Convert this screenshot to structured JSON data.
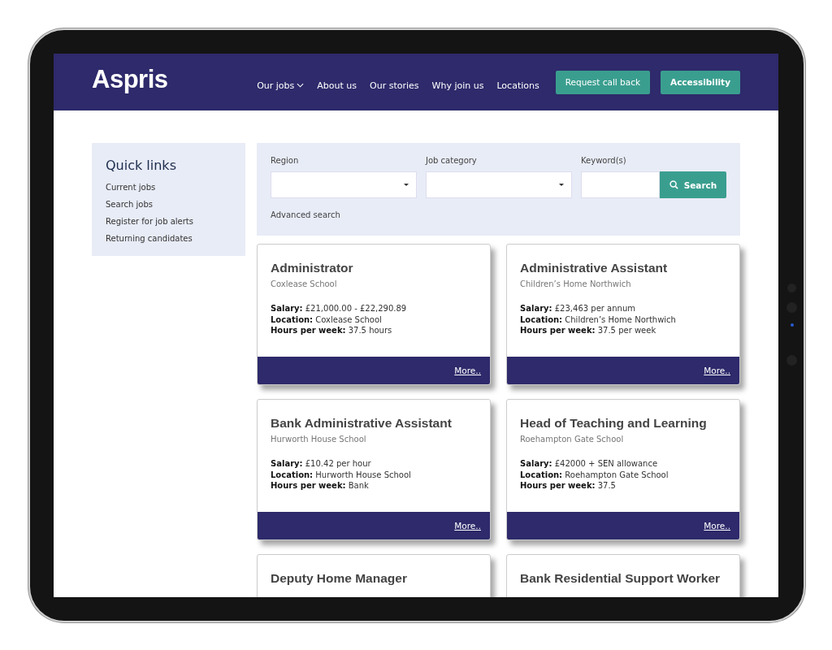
{
  "header": {
    "logo": "Aspris",
    "nav": [
      {
        "label": "Our jobs",
        "dropdown": true
      },
      {
        "label": "About us",
        "dropdown": false
      },
      {
        "label": "Our stories",
        "dropdown": false
      },
      {
        "label": "Why join us",
        "dropdown": false
      },
      {
        "label": "Locations",
        "dropdown": false
      }
    ],
    "buttons": [
      {
        "label": "Request call back",
        "kind": "normal"
      },
      {
        "label": "Accessibility",
        "kind": "bold"
      }
    ]
  },
  "quick_links": {
    "title": "Quick links",
    "items": [
      "Current jobs",
      "Search jobs",
      "Register for job alerts",
      "Returning candidates"
    ]
  },
  "search": {
    "fields": [
      {
        "label": "Region",
        "kind": "select"
      },
      {
        "label": "Job category",
        "kind": "select"
      },
      {
        "label": "Keyword(s)",
        "kind": "text"
      }
    ],
    "button": "Search",
    "advanced": "Advanced search"
  },
  "jobs": [
    {
      "title": "Administrator",
      "place": "Coxlease School",
      "details": [
        {
          "label": "Salary:",
          "value": "£21,000.00 - £22,290.89"
        },
        {
          "label": "Location:",
          "value": "Coxlease School"
        },
        {
          "label": "Hours per week:",
          "value": "37.5 hours"
        }
      ],
      "more": "More.."
    },
    {
      "title": "Administrative Assistant",
      "place": "Children’s Home Northwich",
      "details": [
        {
          "label": "Salary:",
          "value": "£23,463 per annum"
        },
        {
          "label": "Location:",
          "value": "Children’s Home Northwich"
        },
        {
          "label": "Hours per week:",
          "value": "37.5 per week"
        }
      ],
      "more": "More.."
    },
    {
      "title": "Bank Administrative Assistant",
      "place": "Hurworth House School",
      "details": [
        {
          "label": "Salary:",
          "value": "£10.42 per hour"
        },
        {
          "label": "Location:",
          "value": "Hurworth House School"
        },
        {
          "label": "Hours per week:",
          "value": "Bank"
        }
      ],
      "more": "More.."
    },
    {
      "title": "Head of Teaching and Learning",
      "place": "Roehampton Gate School",
      "details": [
        {
          "label": "Salary:",
          "value": "£42000 + SEN allowance"
        },
        {
          "label": "Location:",
          "value": "Roehampton Gate School"
        },
        {
          "label": "Hours per week:",
          "value": "37.5"
        }
      ],
      "more": "More.."
    },
    {
      "title": "Deputy Home Manager"
    },
    {
      "title": "Bank Residential Support Worker"
    }
  ]
}
